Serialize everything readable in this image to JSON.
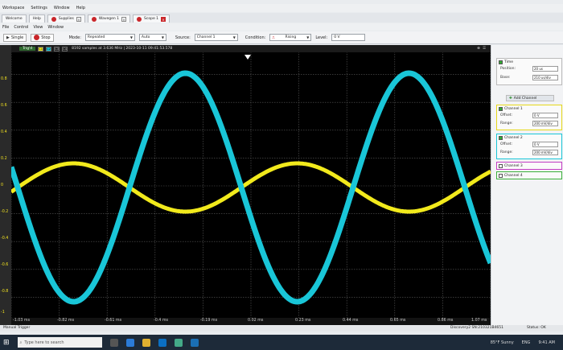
{
  "menubar": {
    "items": [
      "Workspace",
      "Settings",
      "Window",
      "Help"
    ]
  },
  "tabs": [
    {
      "label": "Welcome",
      "active": false
    },
    {
      "label": "Help",
      "active": false
    },
    {
      "label": "Supplies",
      "active": false
    },
    {
      "label": "Wavegen 1",
      "active": false
    },
    {
      "label": "Scope 1",
      "active": true
    }
  ],
  "filemenu": {
    "items": [
      "File",
      "Control",
      "View",
      "Window"
    ]
  },
  "toolbar": {
    "single_label": "Single",
    "stop_label": "Stop",
    "mode_label": "Mode:",
    "mode_value": "Repeated",
    "auto_value": "Auto",
    "source_label": "Source:",
    "source_value": "Channel 1",
    "condition_label": "Condition:",
    "condition_value": "Rising",
    "level_label": "Level:",
    "level_value": "0 V"
  },
  "plot_header": {
    "trig_label": "Trig'd",
    "channel_chips": [
      "C1",
      "C2",
      "C3",
      "C4"
    ],
    "info": "8192 samples at 3.636 MHz | 2023-10-11 09:41:53.578"
  },
  "y_labels": [
    "0.8",
    "0.6",
    "0.4",
    "0.2",
    "0",
    "-0.2",
    "-0.4",
    "-0.6",
    "-0.8",
    "-1"
  ],
  "x_labels": [
    "-1.03 ms",
    "-0.82 ms",
    "-0.61 ms",
    "-0.4 ms",
    "-0.19 ms",
    "0.02 ms",
    "0.23 ms",
    "0.44 ms",
    "0.65 ms",
    "0.86 ms",
    "1.07 ms"
  ],
  "colors": {
    "ch1": "#f2ea1c",
    "ch2": "#19c6d8",
    "grid": "#5a5a5a",
    "bg": "#000000"
  },
  "panel": {
    "time_label": "Time",
    "position_label": "Position:",
    "position_value": "20 us",
    "base_label": "Base:",
    "base_value": "210 us/div",
    "add_channel": "Add Channel",
    "channels": [
      {
        "name": "Channel 1",
        "offset_label": "Offset:",
        "offset": "0 V",
        "range_label": "Range:",
        "range": "200 mV/div",
        "checked": true
      },
      {
        "name": "Channel 2",
        "offset_label": "Offset:",
        "offset": "0 V",
        "range_label": "Range:",
        "range": "200 mV/div",
        "checked": true
      },
      {
        "name": "Channel 3",
        "checked": false
      },
      {
        "name": "Channel 4",
        "checked": false
      }
    ]
  },
  "status": {
    "left": "Manual Trigger",
    "device": "Discovery2 SN:210321B4651",
    "right": "Status: OK"
  },
  "taskbar": {
    "search_placeholder": "Type here to search",
    "weather": "85°F Sunny",
    "lang": "ENG",
    "time": "9:41 AM"
  }
}
